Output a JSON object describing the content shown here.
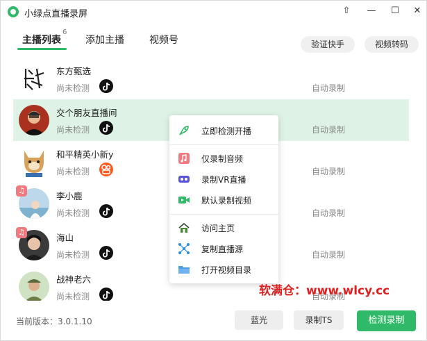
{
  "app": {
    "title": "小绿点直播录屏"
  },
  "window_controls": {
    "pin": "⇧",
    "minimize": "—",
    "maximize": "☐",
    "close": "✕"
  },
  "tabs": [
    {
      "label": "主播列表",
      "badge": "6",
      "active": true
    },
    {
      "label": "添加主播"
    },
    {
      "label": "视频号"
    }
  ],
  "header_buttons": {
    "verify": "验证快手",
    "transcode": "视频转码"
  },
  "streamers": [
    {
      "name": "东方甄选",
      "status": "尚未检测",
      "platform": "douyin",
      "record_mode": "自动录制"
    },
    {
      "name": "交个朋友直播间",
      "status": "尚未检测",
      "platform": "douyin",
      "record_mode": "自动录制",
      "selected": true
    },
    {
      "name": "和平精英小新y",
      "status": "尚未检测",
      "platform": "kuaishou",
      "record_mode": "自动录制"
    },
    {
      "name": "李小鹿",
      "status": "尚未检测",
      "platform": "douyin",
      "record_mode": "自动录制",
      "audio_only": true
    },
    {
      "name": "海山",
      "status": "尚未检测",
      "platform": "douyin",
      "record_mode": "自动录制",
      "audio_only": true
    },
    {
      "name": "战神老六",
      "status": "尚未检测",
      "platform": "douyin",
      "record_mode": "自动录制"
    }
  ],
  "context_menu": {
    "check_live": "立即检测开播",
    "audio_only": "仅录制音频",
    "record_vr": "录制VR直播",
    "default_video": "默认录制视频",
    "visit_home": "访问主页",
    "copy_source": "复制直播源",
    "open_dir": "打开视频目录"
  },
  "icons": {
    "check_live": "rocket-icon",
    "audio_only": "music-note-icon",
    "record_vr": "vr-headset-icon",
    "default_video": "video-camera-icon",
    "visit_home": "home-icon",
    "copy_source": "share-nodes-icon",
    "open_dir": "folder-icon"
  },
  "footer": {
    "version": "当前版本：3.0.1.10",
    "bluray": "蓝光",
    "record_ts": "录制TS",
    "detect_record": "检测录制"
  },
  "watermark": "软满仓：www.wlcy.cc",
  "colors": {
    "accent": "#2fb968",
    "selected_row": "#def3e6",
    "douyin": "#111111",
    "kuaishou": "#ff5a1f",
    "audio_badge": "#f07a80"
  }
}
